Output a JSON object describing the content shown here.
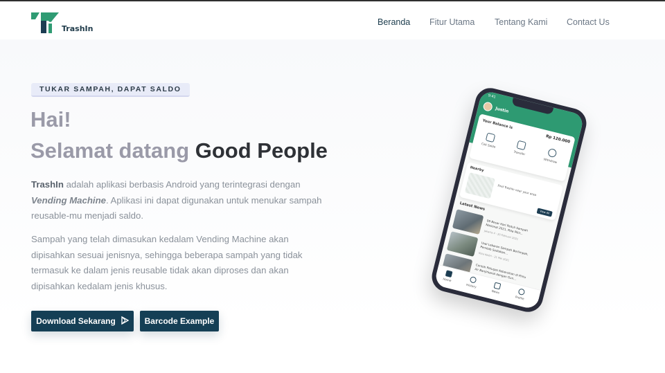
{
  "brand": {
    "name": "TrashIn"
  },
  "nav": {
    "items": [
      {
        "label": "Beranda",
        "active": true
      },
      {
        "label": "Fitur Utama",
        "active": false
      },
      {
        "label": "Tentang Kami",
        "active": false
      },
      {
        "label": "Contact Us",
        "active": false
      }
    ]
  },
  "hero": {
    "badge": "TUKAR SAMPAH, DAPAT SALDO",
    "greeting": "Hai!",
    "welcome_prefix": "Selamat datang ",
    "welcome_strong": "Good People",
    "para1": {
      "brand": "TrashIn",
      "text_a": " adalah aplikasi berbasis Android yang terintegrasi dengan ",
      "emph": "Vending Machine",
      "text_b": ". Aplikasi ini dapat digunakan untuk menukar sampah reusable-mu menjadi saldo."
    },
    "para2": "Sampah yang telah dimasukan kedalam Vending Machine akan dipisahkan sesuai jenisnya, sehingga beberapa sampah yang tidak termasuk ke dalam jenis reusable tidak akan diproses dan akan dipisahkan kedalam jenis khusus.",
    "buttons": {
      "download": "Download Sekarang",
      "barcode": "Barcode Example"
    }
  },
  "phone": {
    "status_time": "9:41",
    "user": "Justin",
    "balance_label": "Your Balance is",
    "balance_value": "Rp 120.000",
    "actions": [
      "Cek Saldo",
      "Transfer",
      "Withdraw"
    ],
    "nearby_title": "Nearby",
    "nearby_text": "Find TrashIn near your area",
    "view_all": "View All",
    "news_title": "Latest News",
    "news": [
      {
        "title": "99 Besar Hari Peduli Sampah Nasional 2021, Pola Pikir...",
        "date": "Jakarta 4 - 20 Februari 2021"
      },
      {
        "title": "Usai Lebaran Sampah Berlimpah, Pemkab Sediakan...",
        "date": "Kota Kediri - 21 Mei 2021"
      },
      {
        "title": "Contoh Petugas Kebersihan di Pintu Air Banjirkanal dengan Gun...",
        "date": ""
      }
    ],
    "bottom_nav": [
      "Home",
      "History",
      "News",
      "Profile"
    ]
  },
  "colors": {
    "primary": "#153f55",
    "app_green": "#2e9a72",
    "nav_active": "#1c3c4d",
    "nav_inactive": "#6b7785"
  }
}
